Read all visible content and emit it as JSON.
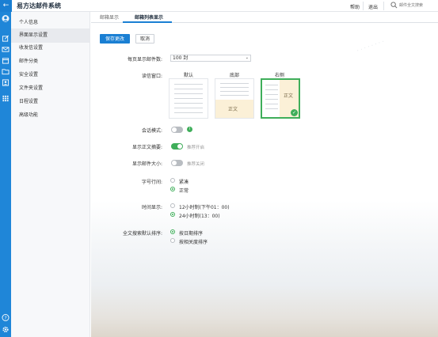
{
  "header": {
    "app_title": "易方达邮件系统",
    "links": [
      "帮助",
      "退出"
    ],
    "search_placeholder": "邮件全文搜索"
  },
  "rail": {
    "icons": [
      "back-icon",
      "avatar-icon",
      "compose-icon",
      "mail-icon",
      "calendar-icon",
      "folder-icon",
      "contacts-icon",
      "apps-grid-icon",
      "help-icon",
      "settings-icon"
    ]
  },
  "menu": {
    "items": [
      "个人信息",
      "界面显示设置",
      "收发信设置",
      "邮件分类",
      "安全设置",
      "文件夹设置",
      "日程设置",
      "高级功能"
    ],
    "active_index": 1
  },
  "tabs": [
    "邮箱显示",
    "邮箱列表显示"
  ],
  "actions": {
    "save": "保存更改",
    "cancel": "取消"
  },
  "form": {
    "per_page_label": "每页显示邮件数:",
    "per_page_value": "100 封",
    "reading_pane_label": "读信窗口:",
    "reading_pane_options": [
      "默认",
      "底部",
      "右侧"
    ],
    "reading_pane_pane_text": "正文",
    "reading_pane_selected": "右侧",
    "conversation_label": "会话模式:",
    "conversation_on": false,
    "summary_label": "显示正文摘要:",
    "summary_on": true,
    "summary_hint": "推荐开启",
    "size_label": "显示邮件大小:",
    "size_on": false,
    "size_hint": "推荐关闭",
    "line_spacing_label": "字号行间:",
    "line_spacing_options": [
      "紧凑",
      "正常"
    ],
    "line_spacing_selected": "正常",
    "time_label": "时间显示:",
    "time_options": [
      "12小时制(下午01：00)",
      "24小时制(13：00)"
    ],
    "time_selected": "24小时制(13：00)",
    "sort_label": "全文搜索默认排序:",
    "sort_options": [
      "按日期排序",
      "按相关度排序"
    ],
    "sort_selected": "按日期排序"
  },
  "colors": {
    "accent": "#1a7fd3",
    "success": "#3fae5a",
    "rail": "#1f86d8"
  }
}
